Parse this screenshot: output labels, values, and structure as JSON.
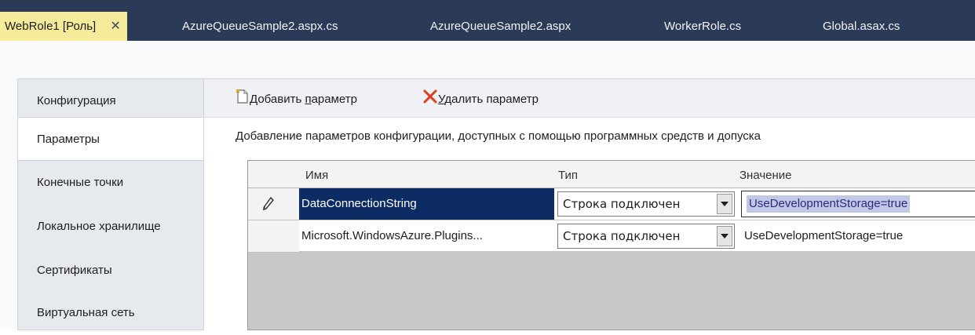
{
  "tabs": [
    {
      "label": "WebRole1 [Роль]",
      "active": true
    },
    {
      "label": "AzureQueueSample2.aspx.cs",
      "active": false
    },
    {
      "label": "AzureQueueSample2.aspx",
      "active": false
    },
    {
      "label": "WorkerRole.cs",
      "active": false
    },
    {
      "label": "Global.asax.cs",
      "active": false
    }
  ],
  "sidebar": {
    "items": [
      {
        "label": "Конфигурация",
        "selected": false
      },
      {
        "label": "Параметры",
        "selected": true
      },
      {
        "label": "Конечные точки",
        "selected": false
      },
      {
        "label": "Локальное хранилище",
        "selected": false
      },
      {
        "label": "Сертификаты",
        "selected": false
      },
      {
        "label": "Виртуальная сеть",
        "selected": false
      }
    ]
  },
  "toolbar": {
    "add_label_prefix": "Добавить ",
    "add_label_underlined": "п",
    "add_label_suffix": "араметр",
    "delete_label_underlined": "У",
    "delete_label_suffix": "далить параметр"
  },
  "description": "Добавление параметров конфигурации, доступных с помощью программных средств и допуска",
  "grid": {
    "columns": {
      "name": "Имя",
      "type": "Тип",
      "value": "Значение"
    },
    "rows": [
      {
        "name": "DataConnectionString",
        "type": "Строка подключен",
        "value": "UseDevelopmentStorage=true",
        "selected": true,
        "editing": true
      },
      {
        "name": "Microsoft.WindowsAzure.Plugins...",
        "type": "Строка подключен",
        "value": "UseDevelopmentStorage=true",
        "selected": false,
        "editing": false
      }
    ]
  },
  "colors": {
    "tabbar": "#2b3a56",
    "active_tab": "#f6eb9a",
    "selected_cell": "#0c2c63",
    "delete_icon": "#e03c1e"
  },
  "icons": [
    "close-icon",
    "add-document-icon",
    "delete-x-icon",
    "pencil-edit-icon",
    "dropdown-arrow-icon"
  ]
}
